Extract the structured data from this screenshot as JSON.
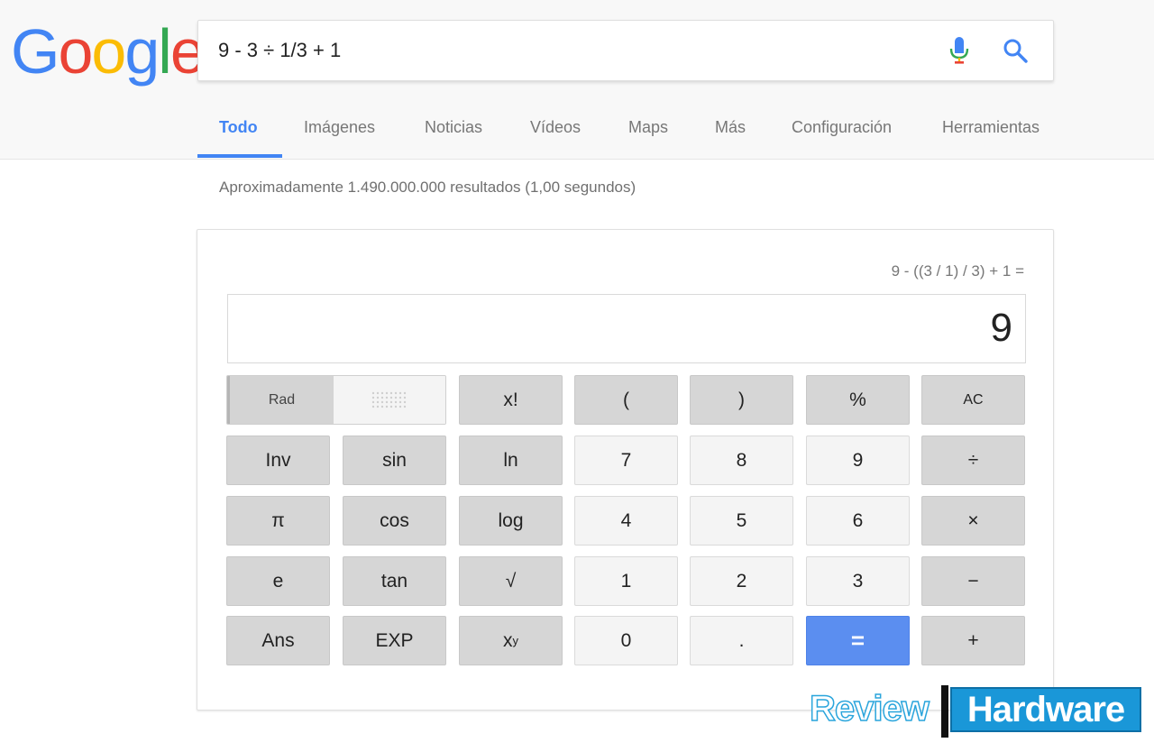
{
  "logo": {
    "letters": [
      "G",
      "o",
      "o",
      "g",
      "l",
      "e"
    ],
    "colors": [
      "#4285f4",
      "#ea4335",
      "#fbbc05",
      "#4285f4",
      "#34a853",
      "#ea4335"
    ]
  },
  "search": {
    "query": "9 - 3 ÷ 1/3 + 1"
  },
  "tabs": [
    {
      "label": "Todo",
      "active": true
    },
    {
      "label": "Imágenes"
    },
    {
      "label": "Noticias"
    },
    {
      "label": "Vídeos"
    },
    {
      "label": "Maps"
    },
    {
      "label": "Más"
    },
    {
      "label": "Configuración"
    },
    {
      "label": "Herramientas"
    }
  ],
  "results": {
    "stats": "Aproximadamente 1.490.000.000 resultados (1,00 segundos)"
  },
  "calculator": {
    "history": "9 - ((3 / 1) / 3) + 1 =",
    "display": "9",
    "mode": {
      "rad": "Rad",
      "deg_icon": "dotted-grid-icon"
    },
    "keys": {
      "factorial": "x!",
      "open_paren": "(",
      "close_paren": ")",
      "percent": "%",
      "clear": "AC",
      "inv": "Inv",
      "sin": "sin",
      "ln": "ln",
      "seven": "7",
      "eight": "8",
      "nine": "9",
      "divide": "÷",
      "pi": "π",
      "cos": "cos",
      "log": "log",
      "four": "4",
      "five": "5",
      "six": "6",
      "multiply": "×",
      "e": "e",
      "tan": "tan",
      "sqrt": "√",
      "one": "1",
      "two": "2",
      "three": "3",
      "minus": "−",
      "ans": "Ans",
      "exp": "EXP",
      "power_base": "x",
      "power_exp": "y",
      "zero": "0",
      "dot": ".",
      "equals": "=",
      "plus": "+"
    }
  },
  "watermark": {
    "left": "Review",
    "right": "Hardware"
  },
  "colors": {
    "accent": "#4285f4",
    "equals_key": "#5b8ef0"
  }
}
